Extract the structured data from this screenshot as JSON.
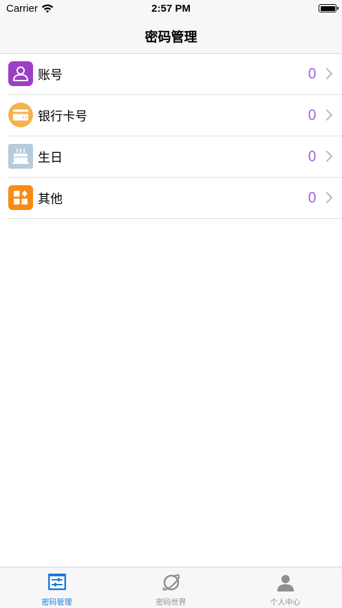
{
  "status_bar": {
    "carrier": "Carrier",
    "time": "2:57 PM"
  },
  "nav": {
    "title": "密码管理"
  },
  "list": {
    "items": [
      {
        "label": "账号",
        "count": "0",
        "icon": "person-icon",
        "color": "#9b3fc4"
      },
      {
        "label": "银行卡号",
        "count": "0",
        "icon": "bank-card-icon",
        "color": "#f6b24e"
      },
      {
        "label": "生日",
        "count": "0",
        "icon": "birthday-cake-icon",
        "color": "#b6cbdc"
      },
      {
        "label": "其他",
        "count": "0",
        "icon": "grid-icon",
        "color": "#f98b16"
      }
    ]
  },
  "tabs": [
    {
      "label": "密码管理",
      "icon": "password-manage-icon",
      "active": true
    },
    {
      "label": "密码世界",
      "icon": "planet-icon",
      "active": false
    },
    {
      "label": "个人中心",
      "icon": "profile-icon",
      "active": false
    }
  ],
  "colors": {
    "accent": "#1a7ae0",
    "count": "#a36bd8"
  }
}
